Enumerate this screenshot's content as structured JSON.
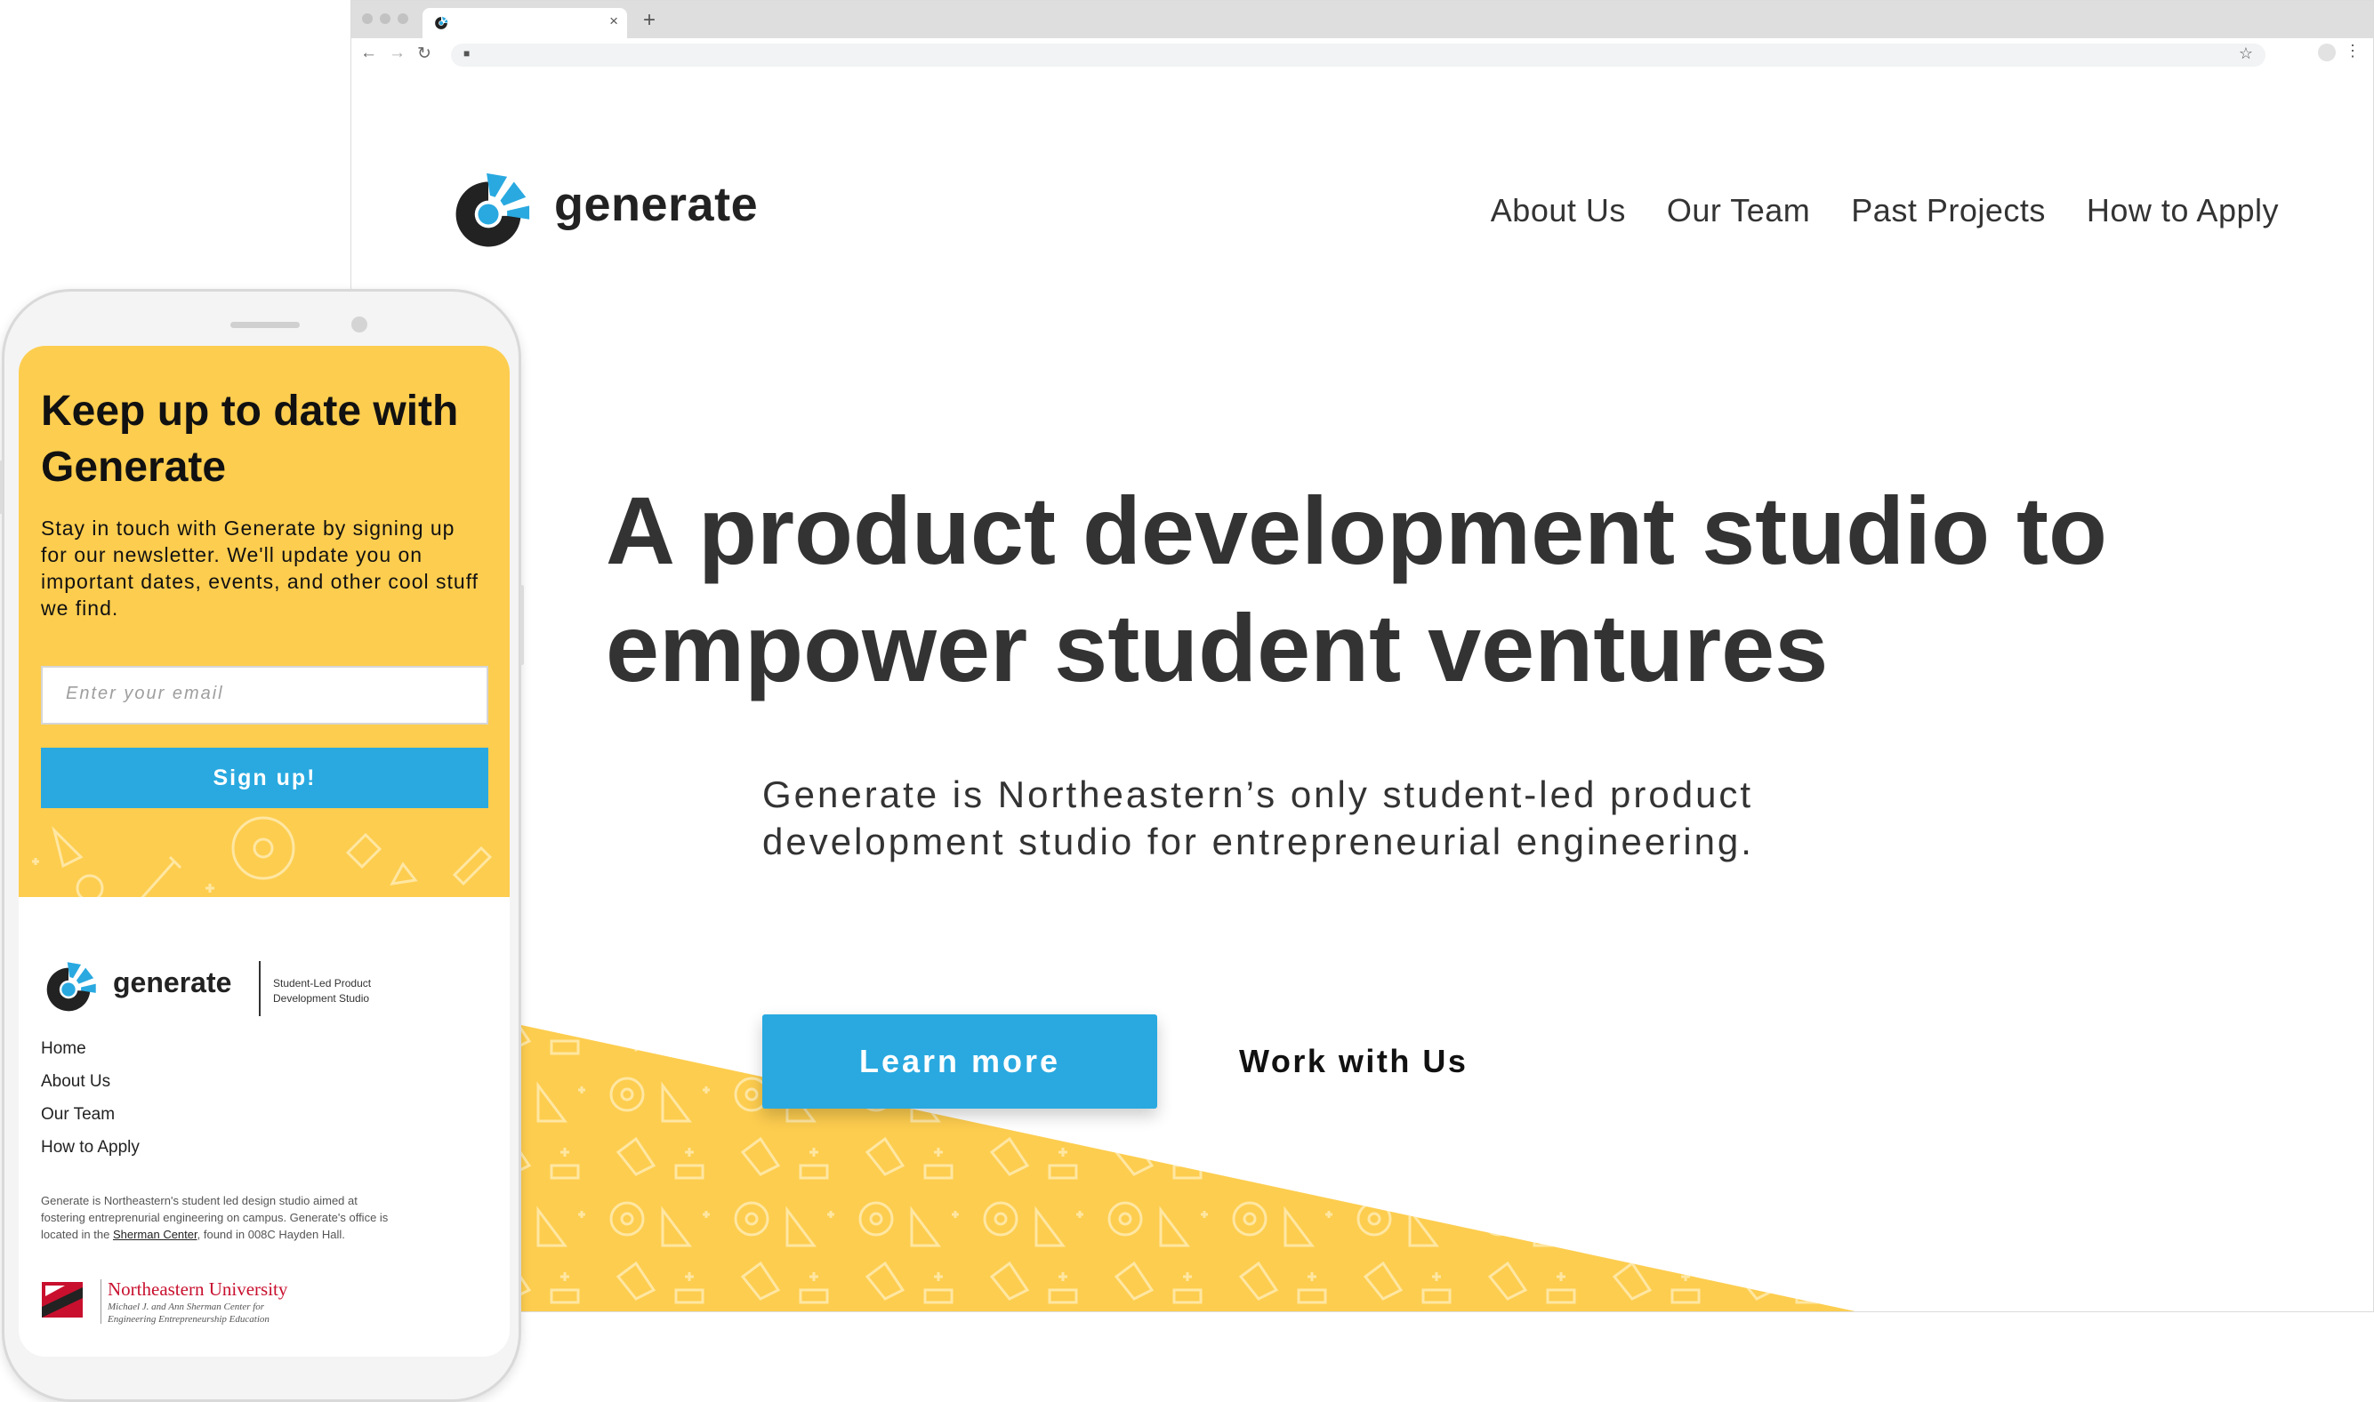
{
  "browser": {
    "tab_close": "×",
    "new_tab": "+",
    "back": "←",
    "forward": "→",
    "reload": "↻",
    "star": "☆",
    "menu": "⋮"
  },
  "site": {
    "brand": "generate",
    "nav": [
      "About Us",
      "Our Team",
      "Past Projects",
      "How to Apply"
    ],
    "hero_title": "A product development studio to empower student ventures",
    "hero_subtitle": "Generate is Northeastern’s only student-led product development studio for entrepreneurial engineering.",
    "primary_cta": "Learn more",
    "secondary_cta": "Work with Us",
    "colors": {
      "accent_blue": "#29a9e0",
      "accent_yellow": "#fdcd4f",
      "text_dark": "#333333"
    }
  },
  "mobile": {
    "newsletter_title": "Keep up to date with Generate",
    "newsletter_text": "Stay in touch with Generate by signing up for our newsletter. We'll update you on important dates, events, and other cool stuff we find.",
    "email_placeholder": "Enter your email",
    "signup_label": "Sign up!",
    "footer": {
      "brand": "generate",
      "tagline_line1": "Student-Led Product",
      "tagline_line2": "Development Studio",
      "links": [
        "Home",
        "About Us",
        "Our Team",
        "How to Apply"
      ],
      "desc_part1": "Generate is Northeastern's student led design studio aimed at fostering entreprenurial engineering on campus. Generate's office is located in the ",
      "desc_link": "Sherman Center",
      "desc_part2": ", found in 008C Hayden Hall.",
      "university_name": "Northeastern University",
      "university_sub_line1": "Michael J. and Ann Sherman Center for",
      "university_sub_line2": "Engineering Entrepreneurship Education"
    }
  }
}
